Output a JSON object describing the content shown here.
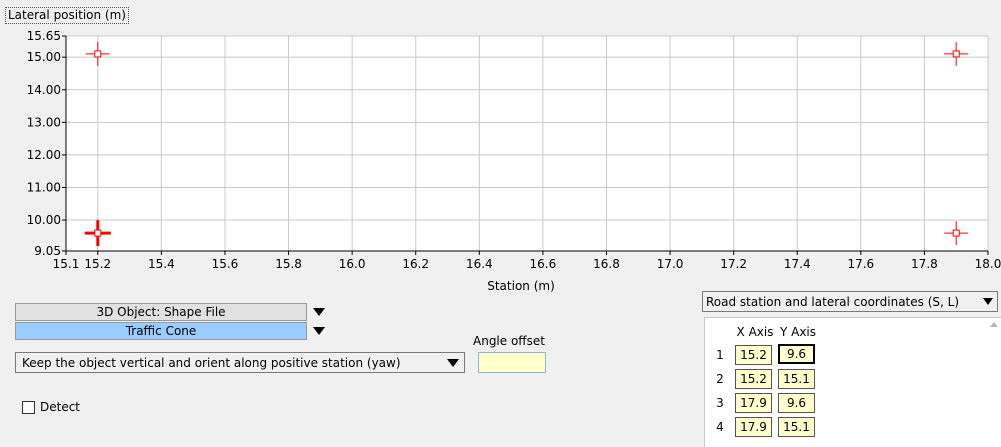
{
  "chart_data": {
    "type": "scatter",
    "xlabel": "Station (m)",
    "ylabel": "Lateral position (m)",
    "xlim": [
      15.1,
      18.0
    ],
    "ylim": [
      9.05,
      15.65
    ],
    "x_ticks": [
      "15.1",
      "15.2",
      "15.4",
      "15.6",
      "15.8",
      "16.0",
      "16.2",
      "16.4",
      "16.6",
      "16.8",
      "17.0",
      "17.2",
      "17.4",
      "17.6",
      "17.8",
      "18.0"
    ],
    "x_tick_values": [
      15.1,
      15.2,
      15.4,
      15.6,
      15.8,
      16.0,
      16.2,
      16.4,
      16.6,
      16.8,
      17.0,
      17.2,
      17.4,
      17.6,
      17.8,
      18.0
    ],
    "y_ticks": [
      "15.65",
      "15.00",
      "14.00",
      "13.00",
      "12.00",
      "11.00",
      "10.00",
      "9.05"
    ],
    "y_tick_values": [
      15.65,
      15.0,
      14.0,
      13.0,
      12.0,
      11.0,
      10.0,
      9.05
    ],
    "grid": true,
    "marker_color": "#ff0000",
    "points": [
      {
        "x": 15.2,
        "y": 9.6,
        "selected": true
      },
      {
        "x": 15.2,
        "y": 15.1,
        "selected": false
      },
      {
        "x": 17.9,
        "y": 9.6,
        "selected": false
      },
      {
        "x": 17.9,
        "y": 15.1,
        "selected": false
      }
    ]
  },
  "controls": {
    "object_type": "3D Object: Shape File",
    "object_name": "Traffic Cone",
    "orientation": "Keep the object vertical and orient along positive station (yaw)",
    "angle_offset_label": "Angle offset",
    "angle_offset_value": "",
    "detect_label": "Detect",
    "detect_checked": false,
    "coordinate_system": "Road station and lateral coordinates (S, L)"
  },
  "table": {
    "col_x": "X Axis",
    "col_y": "Y Axis",
    "rows": [
      {
        "n": "1",
        "x": "15.2",
        "y": "9.6"
      },
      {
        "n": "2",
        "x": "15.2",
        "y": "15.1"
      },
      {
        "n": "3",
        "x": "17.9",
        "y": "9.6"
      },
      {
        "n": "4",
        "x": "17.9",
        "y": "15.1"
      }
    ]
  },
  "colors": {
    "selected_dropdown": "#99ccff",
    "input_background": "#ffffcc"
  }
}
